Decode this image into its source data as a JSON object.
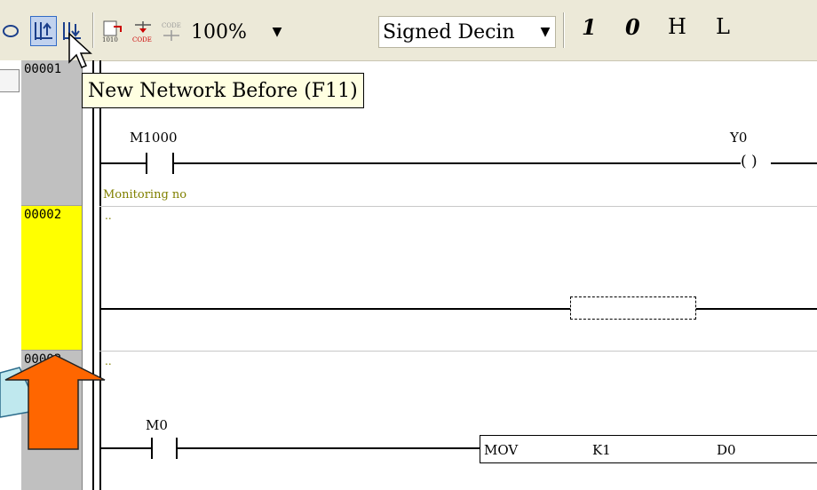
{
  "toolbar": {
    "zoom_value": "100%",
    "format_value": "Signed Decin",
    "btn_1": "1",
    "btn_0": "0",
    "btn_H": "H",
    "btn_L": "L"
  },
  "tooltip": "New Network Before (F11)",
  "networks": [
    {
      "number": "00001",
      "contact": "M1000",
      "coil": "Y0",
      "coil_symbol": "( )",
      "comment": "Monitoring no"
    },
    {
      "number": "00002",
      "comment": ".."
    },
    {
      "number": "00003",
      "comment": "..",
      "contact": "M0",
      "instruction": "MOV",
      "operand1": "K1",
      "operand2": "D0"
    }
  ],
  "colors": {
    "toolbar_bg": "#ece9d8",
    "gutter_gray": "#c0c0c0",
    "gutter_selected": "#ffff00",
    "comment": "#808000",
    "arrow_fill": "#ff6600",
    "callout_fill": "#bfe8ee"
  }
}
